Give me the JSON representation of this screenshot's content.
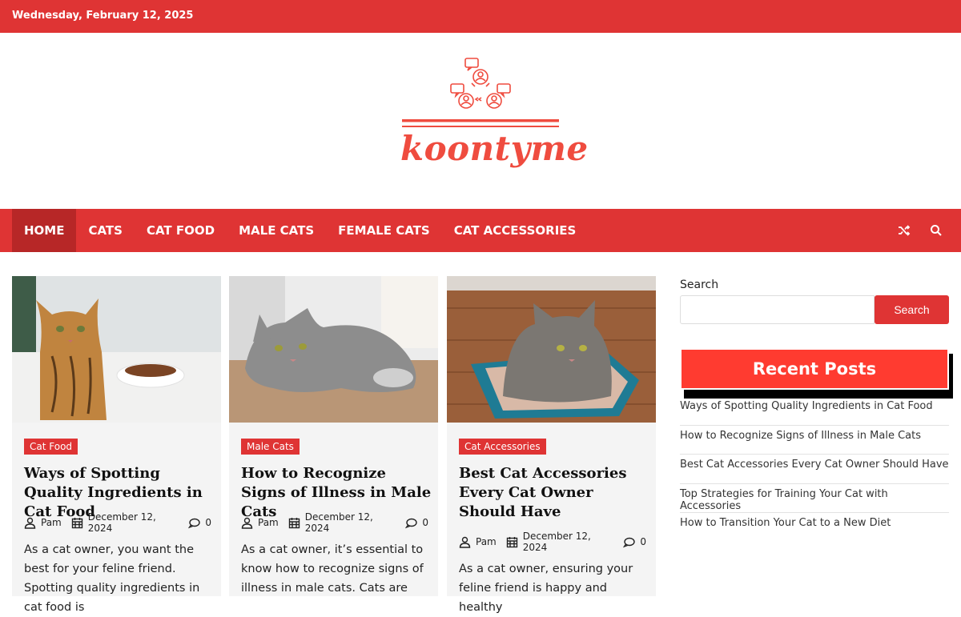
{
  "topbar": {
    "date": "Wednesday, February 12, 2025"
  },
  "site": {
    "name": "koontyme",
    "brand_color": "#df3434"
  },
  "nav": {
    "items": [
      {
        "label": "HOME",
        "active": true
      },
      {
        "label": "CATS"
      },
      {
        "label": "CAT FOOD"
      },
      {
        "label": "MALE CATS"
      },
      {
        "label": "FEMALE CATS"
      },
      {
        "label": "CAT ACCESSORIES"
      }
    ],
    "icons": [
      "shuffle-icon",
      "search-icon"
    ]
  },
  "posts": [
    {
      "category": "Cat Food",
      "title": "Ways of Spotting Quality Ingredients in Cat Food",
      "author": "Pam",
      "date": "December 12, 2024",
      "comments": "0",
      "excerpt": "As a cat owner, you want the best for your feline friend. Spotting quality ingredients in cat food is"
    },
    {
      "category": "Male Cats",
      "title": "How to Recognize Signs of Illness in Male Cats",
      "author": "Pam",
      "date": "December 12, 2024",
      "comments": "0",
      "excerpt": "As a cat owner, it’s essential to know how to recognize signs of illness in male cats. Cats are"
    },
    {
      "category": "Cat Accessories",
      "title": "Best Cat Accessories Every Cat Owner Should Have",
      "author": "Pam",
      "date": "December 12, 2024",
      "comments": "0",
      "excerpt": "As a cat owner, ensuring your feline friend is happy and healthy"
    }
  ],
  "sidebar": {
    "search_label": "Search",
    "search_button": "Search",
    "search_placeholder": "",
    "recent_title": "Recent Posts",
    "recent_posts": [
      "Ways of Spotting Quality Ingredients in Cat Food",
      "How to Recognize Signs of Illness in Male Cats",
      "Best Cat Accessories Every Cat Owner Should Have",
      "Top Strategies for Training Your Cat with Accessories",
      "How to Transition Your Cat to a New Diet"
    ]
  }
}
